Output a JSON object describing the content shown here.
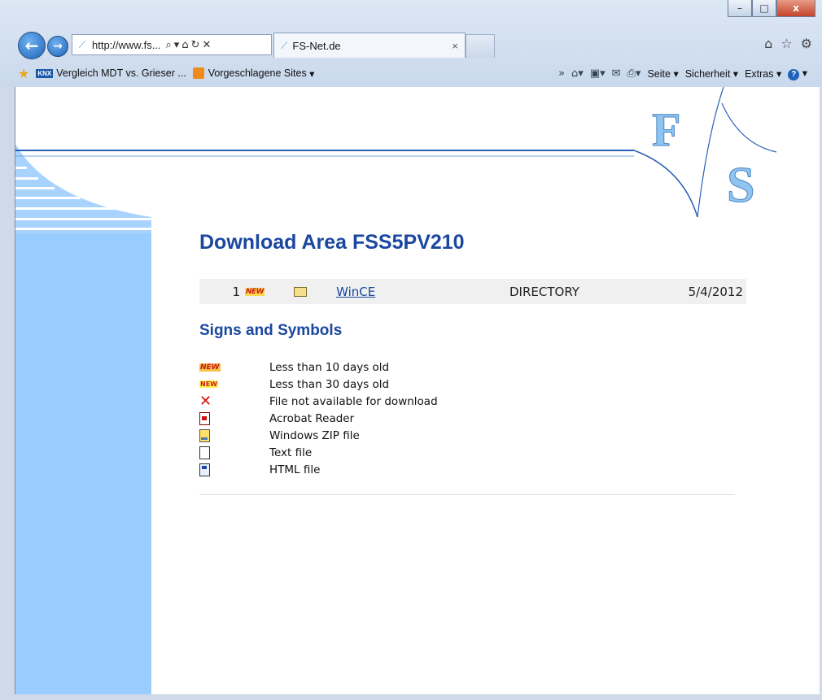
{
  "window": {
    "minimize_glyph": "–",
    "maximize_glyph": "□",
    "close_glyph": "x"
  },
  "navbar": {
    "address": "http://www.fs...",
    "tab_title": "FS-Net.de"
  },
  "favorites_bar": {
    "items": [
      {
        "label": "Vergleich MDT vs. Grieser ...",
        "icon": "knx-icon"
      },
      {
        "label": "Vorgeschlagene Sites",
        "icon": "suggested-sites-icon"
      }
    ]
  },
  "command_bar": {
    "seite": "Seite",
    "sicherheit": "Sicherheit",
    "extras": "Extras"
  },
  "page": {
    "logo_text": [
      "F",
      "S"
    ],
    "title": "Download Area FSS5PV210",
    "rows": [
      {
        "num": "1",
        "badge": "NEW",
        "name": "WinCE",
        "type": "DIRECTORY",
        "date": "5/4/2012"
      }
    ],
    "subtitle": "Signs and Symbols",
    "legend": [
      {
        "icon": "new-10-days-icon",
        "text": "Less than 10 days old"
      },
      {
        "icon": "new-30-days-icon",
        "text": "Less than 30 days old"
      },
      {
        "icon": "not-available-icon",
        "text": "File not available for download"
      },
      {
        "icon": "acrobat-icon",
        "text": "Acrobat Reader"
      },
      {
        "icon": "zip-icon",
        "text": "Windows ZIP file"
      },
      {
        "icon": "text-file-icon",
        "text": "Text file"
      },
      {
        "icon": "html-file-icon",
        "text": "HTML file"
      }
    ],
    "colors": {
      "heading": "#1a47a0",
      "sidebar": "#99ccff"
    }
  }
}
